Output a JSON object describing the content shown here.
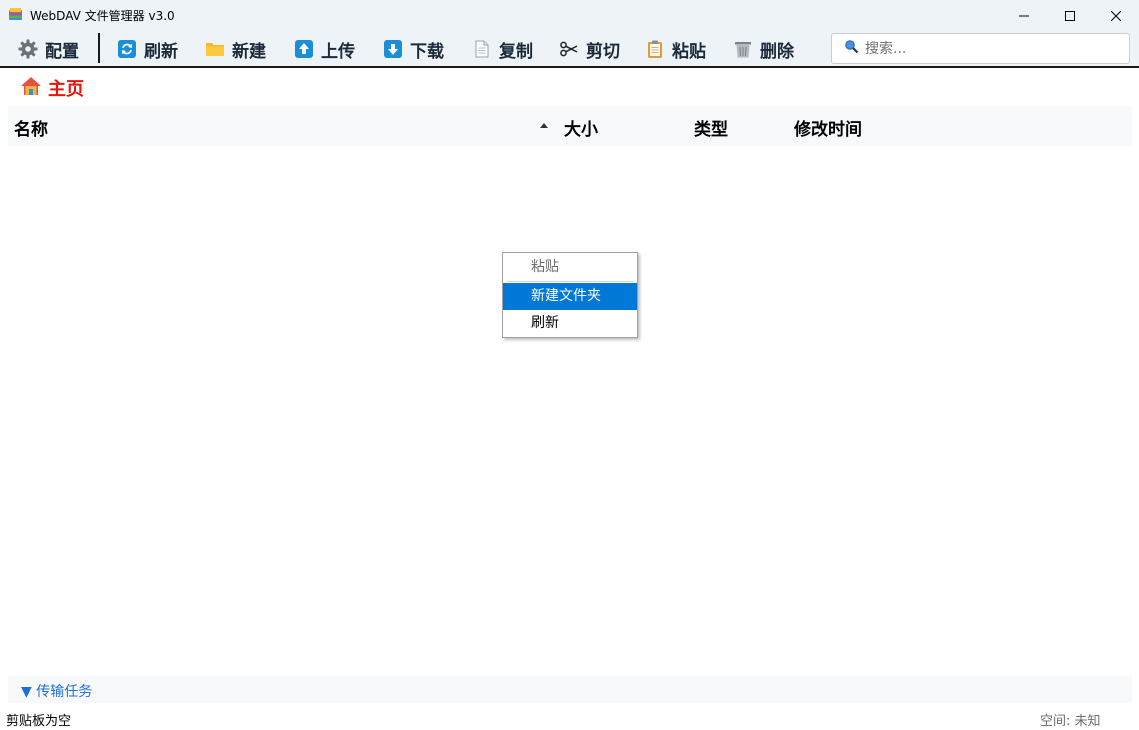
{
  "window": {
    "title": "WebDAV 文件管理器 v3.0",
    "app_icon": "folder-stack-icon",
    "controls": {
      "minimize": "minimize-icon",
      "maximize": "maximize-icon",
      "close": "close-icon"
    }
  },
  "toolbar": {
    "config_label": "配置",
    "refresh_label": "刷新",
    "new_label": "新建",
    "upload_label": "上传",
    "download_label": "下载",
    "copy_label": "复制",
    "cut_label": "剪切",
    "paste_label": "粘贴",
    "delete_label": "删除"
  },
  "search": {
    "placeholder": "搜索...",
    "value": "",
    "icon": "search-icon"
  },
  "breadcrumb": {
    "label": "主页",
    "icon": "home-icon"
  },
  "columns": {
    "name": "名称",
    "size": "大小",
    "type": "类型",
    "modified": "修改时间",
    "sort_column": "名称",
    "sort_direction": "ascending"
  },
  "files": [],
  "context_menu": {
    "paste": "粘贴",
    "new_folder": "新建文件夹",
    "refresh": "刷新",
    "selected_item": "新建文件夹",
    "disabled_item": "粘贴"
  },
  "transfer_panel": {
    "label": "▼ 传输任务"
  },
  "status": {
    "clipboard": "剪贴板为空",
    "space": "空间: 未知"
  },
  "colors": {
    "accent": "#0078d7",
    "breadcrumb": "#e8140c",
    "link": "#1e6fd4",
    "chrome": "#eef3f8"
  }
}
